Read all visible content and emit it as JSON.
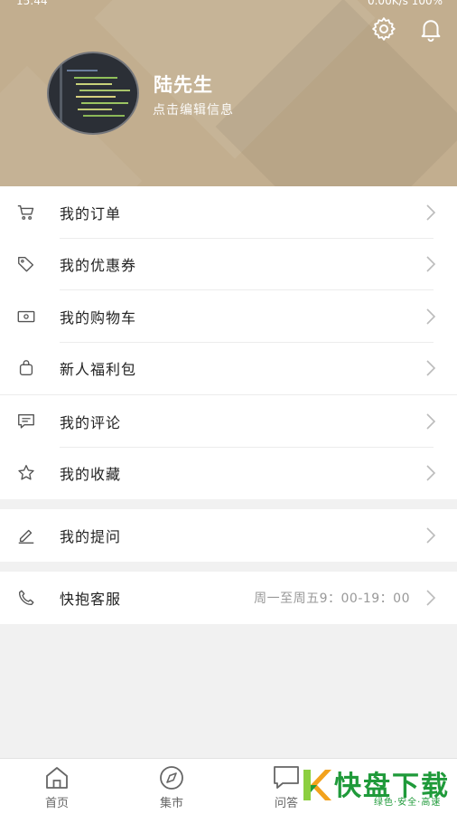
{
  "status_bar": {
    "time": "15:44",
    "right": "0.00K/s  100%"
  },
  "profile": {
    "name": "陆先生",
    "subtitle": "点击编辑信息"
  },
  "header_icons": {
    "settings": "gear-icon",
    "notifications": "bell-icon"
  },
  "menu_group_1": [
    {
      "label": "我的订单",
      "icon": "cart-icon"
    },
    {
      "label": "我的优惠券",
      "icon": "tag-icon"
    },
    {
      "label": "我的购物车",
      "icon": "wallet-icon"
    },
    {
      "label": "新人福利包",
      "icon": "bag-icon"
    },
    {
      "label": "我的评论",
      "icon": "comment-icon"
    },
    {
      "label": "我的收藏",
      "icon": "star-icon"
    }
  ],
  "menu_group_2": [
    {
      "label": "我的提问",
      "icon": "pen-icon"
    }
  ],
  "menu_group_3": [
    {
      "label": "快抱客服",
      "icon": "phone-icon",
      "meta": "周一至周五9：00-19：00"
    }
  ],
  "tabbar": [
    {
      "label": "首页",
      "icon": "home-icon"
    },
    {
      "label": "集市",
      "icon": "compass-icon"
    },
    {
      "label": "问答",
      "icon": "chat-icon"
    }
  ],
  "watermark": {
    "brand": "快盘下载",
    "tagline": "绿色·安全·高速"
  },
  "colors": {
    "header": "#c2ae8f",
    "background": "#f1f1f1",
    "watermark_green": "#1f9a3a"
  }
}
